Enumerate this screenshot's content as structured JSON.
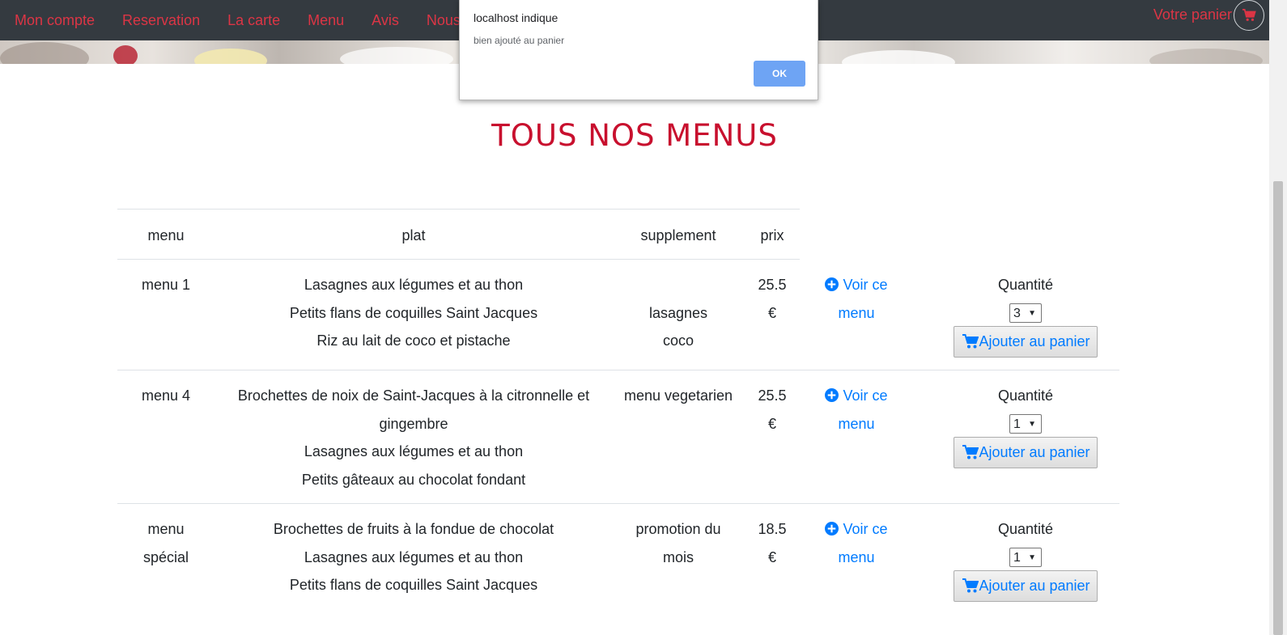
{
  "nav": {
    "links": [
      "Mon compte",
      "Reservation",
      "La carte",
      "Menu",
      "Avis",
      "Nous c"
    ],
    "cart_label": "Votre panier",
    "accent_color": "#dc3545"
  },
  "page": {
    "title": "TOUS NOS MENUS"
  },
  "table": {
    "headers": {
      "menu": "menu",
      "plat": "plat",
      "supplement": "supplement",
      "prix": "prix"
    },
    "rows": [
      {
        "menu": [
          "menu 1"
        ],
        "plats": [
          "Lasagnes aux légumes et au thon",
          "Petits flans de coquilles Saint Jacques",
          "Riz au lait de coco et pistache"
        ],
        "supplement": [
          "",
          "lasagnes",
          "coco"
        ],
        "prix": [
          "25.5",
          "€"
        ],
        "voir": [
          "Voir ce",
          "menu"
        ],
        "quantite_label": "Quantité",
        "quantite": "3",
        "add_label": "Ajouter au panier"
      },
      {
        "menu": [
          "menu 4"
        ],
        "plats": [
          "Brochettes de noix de Saint-Jacques à la citronnelle et",
          "gingembre",
          "Lasagnes aux légumes et au thon",
          "Petits gâteaux au chocolat fondant"
        ],
        "supplement": [
          "menu vegetarien"
        ],
        "prix": [
          "25.5",
          "€"
        ],
        "voir": [
          "Voir ce",
          "menu"
        ],
        "quantite_label": "Quantité",
        "quantite": "1",
        "add_label": "Ajouter au panier"
      },
      {
        "menu": [
          "menu",
          "spécial"
        ],
        "plats": [
          "Brochettes de fruits à la fondue de chocolat",
          "Lasagnes aux légumes et au thon",
          "Petits flans de coquilles Saint Jacques"
        ],
        "supplement": [
          "promotion du",
          "mois"
        ],
        "prix": [
          "18.5",
          "€"
        ],
        "voir": [
          "Voir ce",
          "menu"
        ],
        "quantite_label": "Quantité",
        "quantite": "1",
        "add_label": "Ajouter au panier"
      }
    ]
  },
  "dialog": {
    "title": "localhost indique",
    "message": "bien ajouté au panier",
    "ok_label": "OK"
  },
  "colors": {
    "title_red": "#c8102e",
    "link_blue": "#007bff",
    "navbar": "#343a40"
  }
}
